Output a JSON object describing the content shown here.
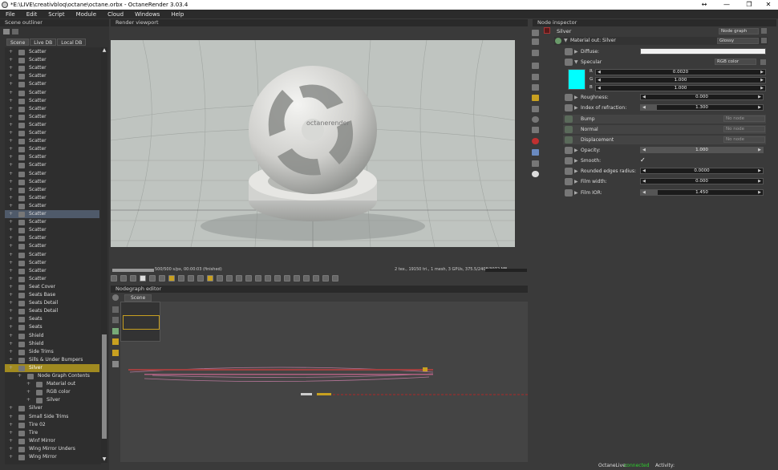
{
  "window": {
    "title": "*E:\\LIVE\\creativbloq\\octane\\octane.orbx - OctaneRender 3.03.4",
    "minimize": "↔",
    "restore": "—",
    "maximize": "❐",
    "close": "✕"
  },
  "menu": [
    "File",
    "Edit",
    "Script",
    "Module",
    "Cloud",
    "Windows",
    "Help"
  ],
  "outliner": {
    "title": "Scene outliner",
    "tabs": [
      "Scene",
      "Live DB",
      "Local DB"
    ],
    "items": [
      {
        "label": "Scatter"
      },
      {
        "label": "Scatter"
      },
      {
        "label": "Scatter"
      },
      {
        "label": "Scatter"
      },
      {
        "label": "Scatter"
      },
      {
        "label": "Scatter"
      },
      {
        "label": "Scatter"
      },
      {
        "label": "Scatter"
      },
      {
        "label": "Scatter"
      },
      {
        "label": "Scatter"
      },
      {
        "label": "Scatter"
      },
      {
        "label": "Scatter"
      },
      {
        "label": "Scatter"
      },
      {
        "label": "Scatter"
      },
      {
        "label": "Scatter"
      },
      {
        "label": "Scatter"
      },
      {
        "label": "Scatter"
      },
      {
        "label": "Scatter"
      },
      {
        "label": "Scatter"
      },
      {
        "label": "Scatter"
      },
      {
        "label": "Scatter",
        "state": "sel"
      },
      {
        "label": "Scatter"
      },
      {
        "label": "Scatter"
      },
      {
        "label": "Scatter"
      },
      {
        "label": "Scatter"
      },
      {
        "label": "Scatter"
      },
      {
        "label": "Scatter"
      },
      {
        "label": "Scatter"
      },
      {
        "label": "Scatter"
      },
      {
        "label": "Seat Cover"
      },
      {
        "label": "Seats Base"
      },
      {
        "label": "Seats Detail"
      },
      {
        "label": "Seats Detail"
      },
      {
        "label": "Seats"
      },
      {
        "label": "Seats"
      },
      {
        "label": "Shield"
      },
      {
        "label": "Shield"
      },
      {
        "label": "Side Trims"
      },
      {
        "label": "Sills & Under Bumpers"
      },
      {
        "label": "Silver",
        "state": "hl"
      },
      {
        "label": "Node Graph Contents",
        "indent": 1
      },
      {
        "label": "Material out",
        "indent": 2
      },
      {
        "label": "RGB color",
        "indent": 2
      },
      {
        "label": "Silver",
        "indent": 2
      },
      {
        "label": "Silver"
      },
      {
        "label": "Small Side Trims"
      },
      {
        "label": "Tire 02"
      },
      {
        "label": "Tire"
      },
      {
        "label": "Winf Mirror"
      },
      {
        "label": "Wing Mirror Unders"
      },
      {
        "label": "Wing Mirror"
      }
    ]
  },
  "viewport": {
    "title": "Render viewport",
    "logo": "octanerender",
    "progress": "500/500 s/px, 00:00:03 (finished)",
    "stats": "2 tex., 19150 tri., 1 mesh, 3 GPUs, 375.5/2408/3072 MB",
    "progress_fraction": 1.0
  },
  "nodegraph": {
    "title": "Nodegraph editor",
    "tab": "Scene"
  },
  "inspector": {
    "title": "Node inspector",
    "node_name": "Silver",
    "graph_dropdown": "Node graph",
    "material_out": "Material out: Silver",
    "material_type": "Glossy",
    "specular_color": "#00ffff",
    "rows": [
      {
        "name": "Diffuse:",
        "kind": "color",
        "color": "#f2f2f2"
      },
      {
        "name": "Specular",
        "kind": "dropdown",
        "value": "RGB color"
      },
      {
        "name": "Roughness:",
        "kind": "slider",
        "value": "0.000",
        "fraction": 0.0
      },
      {
        "name": "Index of refraction:",
        "kind": "slider",
        "value": "1.300",
        "fraction": 0.13
      },
      {
        "name": "Bump",
        "kind": "nonode",
        "value": "No node"
      },
      {
        "name": "Normal",
        "kind": "nonode",
        "value": "No node"
      },
      {
        "name": "Displacement",
        "kind": "nonode",
        "value": "No node"
      },
      {
        "name": "Opacity:",
        "kind": "slider",
        "value": "1.000",
        "fraction": 1.0
      },
      {
        "name": "Smooth:",
        "kind": "check",
        "value": "✓"
      },
      {
        "name": "Rounded edges radius:",
        "kind": "slider",
        "value": "0.0000",
        "fraction": 0.0
      },
      {
        "name": "Film width:",
        "kind": "slider",
        "value": "0.000",
        "fraction": 0.0
      },
      {
        "name": "Film IOR:",
        "kind": "slider",
        "value": "1.450",
        "fraction": 0.14
      }
    ],
    "rgb": [
      {
        "ch": "R",
        "value": "0.0020"
      },
      {
        "ch": "G",
        "value": "1.000"
      },
      {
        "ch": "B",
        "value": "1.000"
      }
    ]
  },
  "status": {
    "live_label": "OctaneLive:",
    "live_value": "connected",
    "activity_label": "Activity:"
  }
}
